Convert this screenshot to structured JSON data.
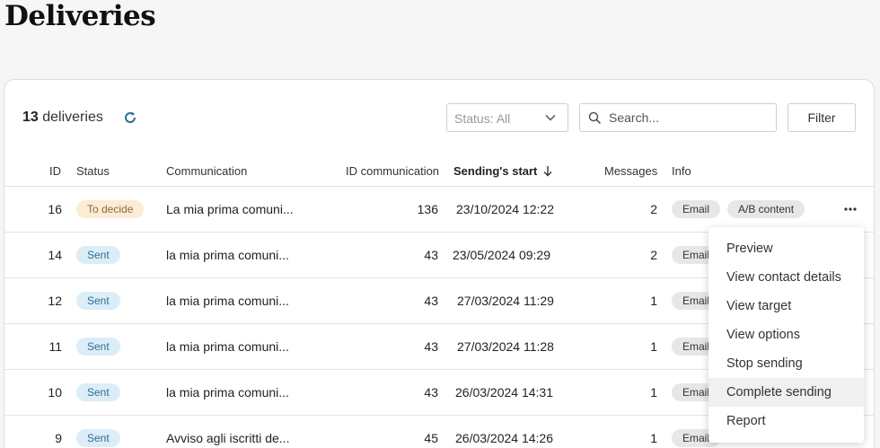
{
  "page": {
    "title": "Deliveries"
  },
  "toolbar": {
    "count_number": "13",
    "count_label": "deliveries",
    "status_select": "Status: All",
    "search_placeholder": "Search...",
    "filter_label": "Filter"
  },
  "table": {
    "headers": {
      "id": "ID",
      "status": "Status",
      "communication": "Communication",
      "id_communication": "ID communication",
      "sending_start": "Sending's start",
      "messages": "Messages",
      "info": "Info"
    },
    "rows": [
      {
        "id": "16",
        "status": "To decide",
        "communication": "La mia prima comuni...",
        "id_communication": "136",
        "sending_start": "23/10/2024 12:22",
        "messages": "2",
        "tags": [
          "Email",
          "A/B content"
        ]
      },
      {
        "id": "14",
        "status": "Sent",
        "communication": "la mia prima comuni...",
        "id_communication": "43",
        "sending_start": "23/05/2024 09:29",
        "messages": "2",
        "tags": [
          "Email"
        ]
      },
      {
        "id": "12",
        "status": "Sent",
        "communication": "la mia prima comuni...",
        "id_communication": "43",
        "sending_start": "27/03/2024 11:29",
        "messages": "1",
        "tags": [
          "Email"
        ]
      },
      {
        "id": "11",
        "status": "Sent",
        "communication": "la mia prima comuni...",
        "id_communication": "43",
        "sending_start": "27/03/2024 11:28",
        "messages": "1",
        "tags": [
          "Email"
        ]
      },
      {
        "id": "10",
        "status": "Sent",
        "communication": "la mia prima comuni...",
        "id_communication": "43",
        "sending_start": "26/03/2024 14:31",
        "messages": "1",
        "tags": [
          "Email"
        ]
      },
      {
        "id": "9",
        "status": "Sent",
        "communication": "Avviso agli iscritti de...",
        "id_communication": "45",
        "sending_start": "26/03/2024 14:26",
        "messages": "1",
        "tags": [
          "Email"
        ]
      }
    ]
  },
  "context_menu": {
    "items": [
      "Preview",
      "View contact details",
      "View target",
      "View options",
      "Stop sending",
      "Complete sending",
      "Report"
    ],
    "hovered": "Complete sending"
  },
  "colors": {
    "to_decide_badge": "#fcebd5",
    "sent_badge": "#dcedf7",
    "accent": "#2a6f97"
  }
}
